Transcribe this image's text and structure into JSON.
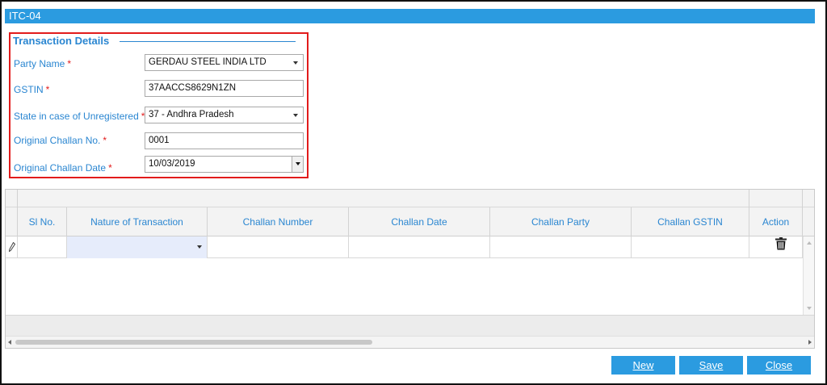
{
  "window": {
    "title": "ITC-04"
  },
  "transaction_details": {
    "legend": "Transaction Details",
    "party_name": {
      "label": "Party Name",
      "value": "GERDAU STEEL INDIA LTD"
    },
    "gstin": {
      "label": "GSTIN",
      "value": "37AACCS8629N1ZN"
    },
    "state": {
      "label": "State in case of Unregistered",
      "value": "37 - Andhra Pradesh"
    },
    "challan_no": {
      "label": "Original Challan No.",
      "value": "0001"
    },
    "challan_date": {
      "label": "Original Challan Date",
      "value": "10/03/2019"
    },
    "required_mark": "*"
  },
  "grid": {
    "columns": [
      "Sl No.",
      "Nature of Transaction",
      "Challan Number",
      "Challan Date",
      "Challan Party",
      "Challan GSTIN",
      "Action"
    ]
  },
  "buttons": {
    "new": "New",
    "save": "Save",
    "close": "Close"
  },
  "colors": {
    "accent": "#2b9be0",
    "label": "#2a86d1",
    "required": "#e21b1b"
  },
  "icons": {
    "row_edit": "pencil-icon",
    "row_delete": "trash-icon"
  }
}
